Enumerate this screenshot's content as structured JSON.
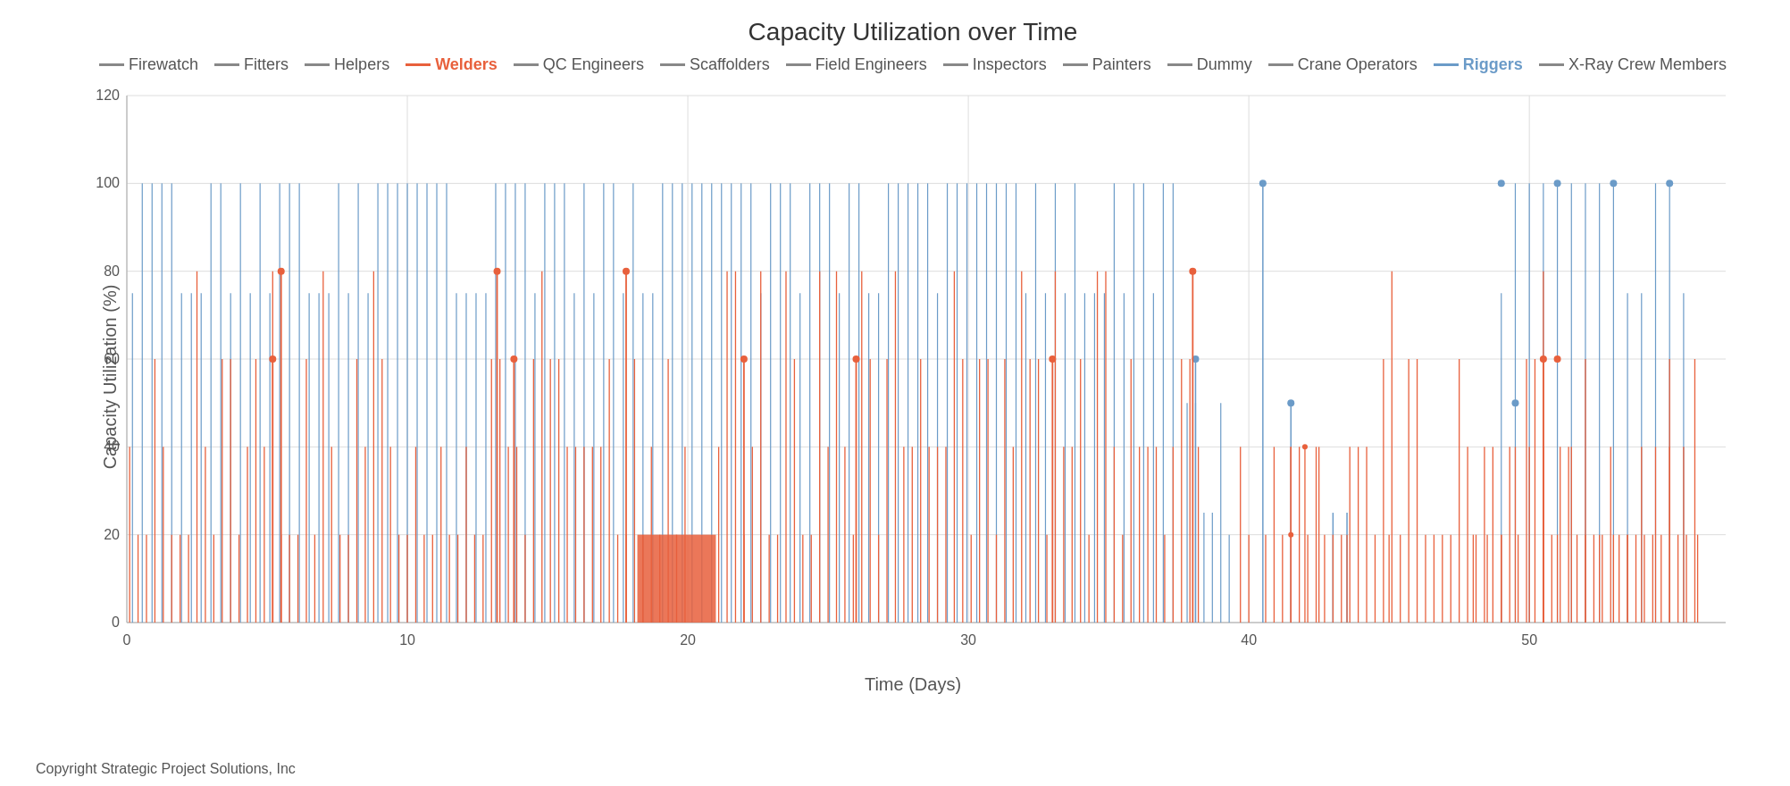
{
  "title": "Capacity Utilization over Time",
  "legend": {
    "items": [
      {
        "label": "Firewatch",
        "color": "#888",
        "bold": false
      },
      {
        "label": "Fitters",
        "color": "#888",
        "bold": false
      },
      {
        "label": "Helpers",
        "color": "#888",
        "bold": false
      },
      {
        "label": "Welders",
        "color": "#e8603c",
        "bold": true
      },
      {
        "label": "QC Engineers",
        "color": "#888",
        "bold": false
      },
      {
        "label": "Scaffolders",
        "color": "#888",
        "bold": false
      },
      {
        "label": "Field Engineers",
        "color": "#888",
        "bold": false
      },
      {
        "label": "Inspectors",
        "color": "#888",
        "bold": false
      },
      {
        "label": "Painters",
        "color": "#888",
        "bold": false
      },
      {
        "label": "Dummy",
        "color": "#888",
        "bold": false
      },
      {
        "label": "Crane Operators",
        "color": "#888",
        "bold": false
      },
      {
        "label": "Riggers",
        "color": "#6b9bc8",
        "bold": true
      },
      {
        "label": "X-Ray Crew Members",
        "color": "#888",
        "bold": false
      }
    ]
  },
  "yAxisLabel": "Capacity Utilization (%)",
  "xAxisLabel": "Time (Days)",
  "yTicks": [
    0,
    20,
    40,
    60,
    80,
    100,
    120
  ],
  "xTicks": [
    0,
    10,
    20,
    30,
    40,
    50
  ],
  "copyright": "Copyright Strategic Project Solutions, Inc",
  "colors": {
    "welders": "#e8603c",
    "riggers": "#6b9bc8",
    "grid": "#e0e0e0"
  }
}
